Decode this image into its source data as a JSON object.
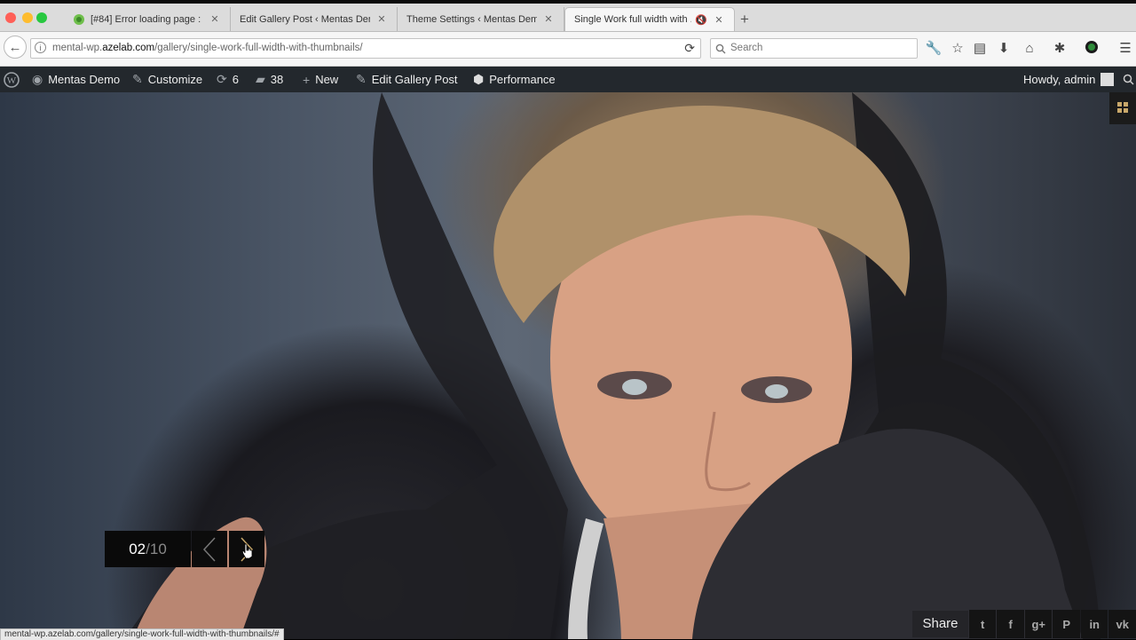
{
  "browser": {
    "tabs": [
      {
        "title": "[#84] Error loading page : ...",
        "active": false
      },
      {
        "title": "Edit Gallery Post ‹ Mentas Dem...",
        "active": false
      },
      {
        "title": "Theme Settings ‹ Mentas Demo...",
        "active": false
      },
      {
        "title": "Single Work full width with ...",
        "active": true
      }
    ],
    "new_tab_label": "+",
    "url_prefix": "mental-wp.",
    "url_domain": "azelab.com",
    "url_path": "/gallery/single-work-full-width-with-thumbnails/",
    "search_placeholder": "Search"
  },
  "wp_admin_bar": {
    "site_name": "Mentas Demo",
    "customize": "Customize",
    "updates_count": "6",
    "comments_count": "38",
    "new_label": "New",
    "edit_label": "Edit Gallery Post",
    "performance_label": "Performance",
    "howdy": "Howdy, admin"
  },
  "gallery": {
    "current": "02",
    "total": "/10",
    "progress": 0.2
  },
  "share": {
    "label": "Share",
    "networks": [
      "twitter",
      "facebook",
      "google-plus",
      "pinterest",
      "linkedin",
      "vk"
    ]
  },
  "status_url": "mental-wp.azelab.com/gallery/single-work-full-width-with-thumbnails/#",
  "colors": {
    "admin_bar": "#23282d",
    "accent": "#c9a86a"
  }
}
